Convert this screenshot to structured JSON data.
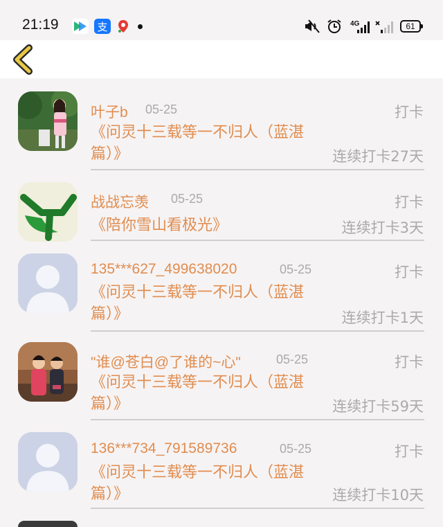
{
  "status_bar": {
    "time": "21:19",
    "signal": "4G",
    "battery": "61",
    "icons": [
      "video-app-icon",
      "alipay-icon",
      "map-pin-icon",
      "mute-icon",
      "alarm-icon",
      "signal-icon",
      "sim-signal-icon",
      "battery-icon"
    ]
  },
  "header": {
    "back_icon": "chevron-left-icon"
  },
  "colors": {
    "accent": "#e08d4f",
    "muted": "#aaaaaa",
    "back_icon": "#e8c845",
    "background": "#f6f3f4"
  },
  "list": [
    {
      "name": "叶子b",
      "date": "05-25",
      "action": "打卡",
      "title": "《问灵十三载等一不归人（蓝湛篇）》",
      "streak": "连续打卡27天",
      "avatar": "photo-girl-garden"
    },
    {
      "name": "战战忘羡",
      "date": "05-25",
      "action": "打卡",
      "title": "《陪你雪山看极光》",
      "streak": "连续打卡3天",
      "avatar": "green-y-logo"
    },
    {
      "name": "135***627_499638020",
      "date": "05-25",
      "action": "打卡",
      "title": "《问灵十三载等一不归人（蓝湛篇）》",
      "streak": "连续打卡1天",
      "avatar": "default-avatar"
    },
    {
      "name": "\"谁@苍白@了谁的~心\"",
      "date": "05-25",
      "action": "打卡",
      "title": "《问灵十三载等一不归人（蓝湛篇）》",
      "streak": "连续打卡59天",
      "avatar": "photo-two-kids"
    },
    {
      "name": "136***734_791589736",
      "date": "05-25",
      "action": "打卡",
      "title": "《问灵十三载等一不归人（蓝湛篇）》",
      "streak": "连续打卡10天",
      "avatar": "default-avatar"
    }
  ]
}
